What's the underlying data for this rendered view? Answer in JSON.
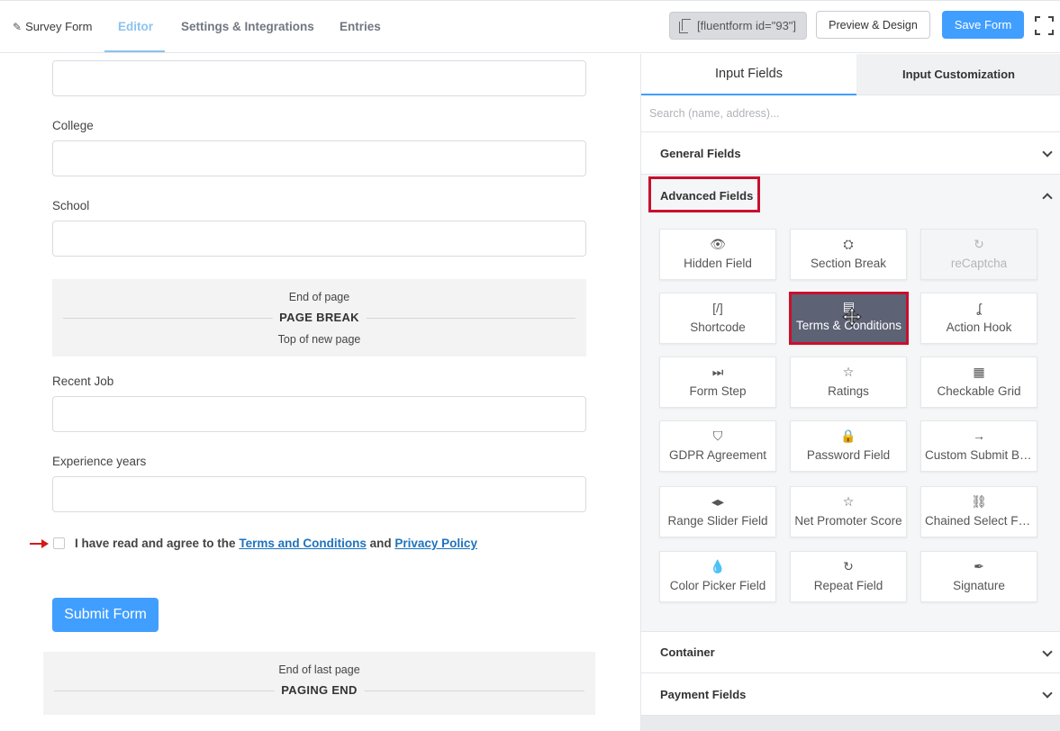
{
  "header": {
    "brand": "Survey Form",
    "tabs": [
      "Editor",
      "Settings & Integrations",
      "Entries"
    ],
    "active_tab": "Editor",
    "shortcode": "[fluentform id=\"93\"]",
    "preview_label": "Preview & Design",
    "save_label": "Save Form"
  },
  "form": {
    "fields": [
      {
        "label": "College"
      },
      {
        "label": "School"
      },
      {
        "label": "Recent Job"
      },
      {
        "label": "Experience years"
      }
    ],
    "page_break": {
      "end": "End of page",
      "title": "PAGE BREAK",
      "top": "Top of new page"
    },
    "terms": {
      "prefix": "I have read and agree to the",
      "terms_link": "Terms and Conditions",
      "and": "and",
      "privacy_link": "Privacy Policy"
    },
    "submit_label": "Submit Form",
    "paging_end": {
      "end": "End of last page",
      "title": "PAGING END"
    }
  },
  "sidebar": {
    "tabs": [
      "Input Fields",
      "Input Customization"
    ],
    "active_tab": "Input Fields",
    "search_placeholder": "Search (name, address)...",
    "sections": {
      "general": "General Fields",
      "advanced": "Advanced Fields",
      "container": "Container",
      "payment": "Payment Fields"
    },
    "advanced_fields": [
      {
        "label": "Hidden Field",
        "icon": "eye-slash-icon",
        "glyph": "👁"
      },
      {
        "label": "Section Break",
        "icon": "puzzle-icon",
        "glyph": "⛭"
      },
      {
        "label": "reCaptcha",
        "icon": "recaptcha-icon",
        "glyph": "↻",
        "disabled": true
      },
      {
        "label": "Shortcode",
        "icon": "shortcode-icon",
        "glyph": "[/]"
      },
      {
        "label": "Terms & Conditions",
        "icon": "file-text-icon",
        "glyph": "▤",
        "selected": true
      },
      {
        "label": "Action Hook",
        "icon": "hook-icon",
        "glyph": "ʆ"
      },
      {
        "label": "Form Step",
        "icon": "step-forward-icon",
        "glyph": "⏭"
      },
      {
        "label": "Ratings",
        "icon": "star-icon",
        "glyph": "☆"
      },
      {
        "label": "Checkable Grid",
        "icon": "grid-check-icon",
        "glyph": "▦"
      },
      {
        "label": "GDPR Agreement",
        "icon": "shield-check-icon",
        "glyph": "⛉"
      },
      {
        "label": "Password Field",
        "icon": "lock-icon",
        "glyph": "🔒"
      },
      {
        "label": "Custom Submit Button",
        "icon": "arrow-right-icon",
        "glyph": "→"
      },
      {
        "label": "Range Slider Field",
        "icon": "range-arrows-icon",
        "glyph": "◂▸"
      },
      {
        "label": "Net Promoter Score",
        "icon": "star-icon",
        "glyph": "☆"
      },
      {
        "label": "Chained Select Field",
        "icon": "link-icon",
        "glyph": "⛓"
      },
      {
        "label": "Color Picker Field",
        "icon": "droplet-icon",
        "glyph": "💧"
      },
      {
        "label": "Repeat Field",
        "icon": "repeat-icon",
        "glyph": "↻"
      },
      {
        "label": "Signature",
        "icon": "pen-icon",
        "glyph": "✒"
      }
    ]
  },
  "colors": {
    "accent": "#409eff",
    "highlight_border": "#c8102e",
    "selected_tile": "#5d6275",
    "active_nav": "#8cc3ee"
  }
}
